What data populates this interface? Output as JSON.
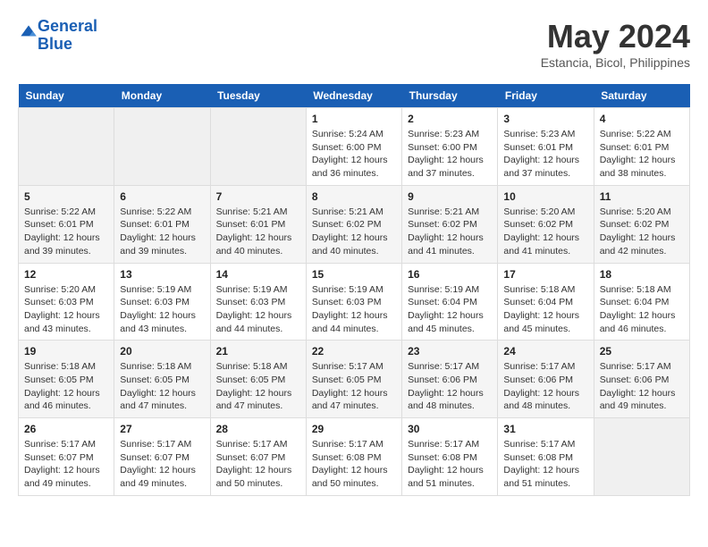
{
  "header": {
    "logo_line1": "General",
    "logo_line2": "Blue",
    "month_title": "May 2024",
    "location": "Estancia, Bicol, Philippines"
  },
  "weekdays": [
    "Sunday",
    "Monday",
    "Tuesday",
    "Wednesday",
    "Thursday",
    "Friday",
    "Saturday"
  ],
  "weeks": [
    [
      {
        "day": "",
        "empty": true
      },
      {
        "day": "",
        "empty": true
      },
      {
        "day": "",
        "empty": true
      },
      {
        "day": "1",
        "sunrise": "5:24 AM",
        "sunset": "6:00 PM",
        "daylight": "12 hours and 36 minutes."
      },
      {
        "day": "2",
        "sunrise": "5:23 AM",
        "sunset": "6:00 PM",
        "daylight": "12 hours and 37 minutes."
      },
      {
        "day": "3",
        "sunrise": "5:23 AM",
        "sunset": "6:01 PM",
        "daylight": "12 hours and 37 minutes."
      },
      {
        "day": "4",
        "sunrise": "5:22 AM",
        "sunset": "6:01 PM",
        "daylight": "12 hours and 38 minutes."
      }
    ],
    [
      {
        "day": "5",
        "sunrise": "5:22 AM",
        "sunset": "6:01 PM",
        "daylight": "12 hours and 39 minutes."
      },
      {
        "day": "6",
        "sunrise": "5:22 AM",
        "sunset": "6:01 PM",
        "daylight": "12 hours and 39 minutes."
      },
      {
        "day": "7",
        "sunrise": "5:21 AM",
        "sunset": "6:01 PM",
        "daylight": "12 hours and 40 minutes."
      },
      {
        "day": "8",
        "sunrise": "5:21 AM",
        "sunset": "6:02 PM",
        "daylight": "12 hours and 40 minutes."
      },
      {
        "day": "9",
        "sunrise": "5:21 AM",
        "sunset": "6:02 PM",
        "daylight": "12 hours and 41 minutes."
      },
      {
        "day": "10",
        "sunrise": "5:20 AM",
        "sunset": "6:02 PM",
        "daylight": "12 hours and 41 minutes."
      },
      {
        "day": "11",
        "sunrise": "5:20 AM",
        "sunset": "6:02 PM",
        "daylight": "12 hours and 42 minutes."
      }
    ],
    [
      {
        "day": "12",
        "sunrise": "5:20 AM",
        "sunset": "6:03 PM",
        "daylight": "12 hours and 43 minutes."
      },
      {
        "day": "13",
        "sunrise": "5:19 AM",
        "sunset": "6:03 PM",
        "daylight": "12 hours and 43 minutes."
      },
      {
        "day": "14",
        "sunrise": "5:19 AM",
        "sunset": "6:03 PM",
        "daylight": "12 hours and 44 minutes."
      },
      {
        "day": "15",
        "sunrise": "5:19 AM",
        "sunset": "6:03 PM",
        "daylight": "12 hours and 44 minutes."
      },
      {
        "day": "16",
        "sunrise": "5:19 AM",
        "sunset": "6:04 PM",
        "daylight": "12 hours and 45 minutes."
      },
      {
        "day": "17",
        "sunrise": "5:18 AM",
        "sunset": "6:04 PM",
        "daylight": "12 hours and 45 minutes."
      },
      {
        "day": "18",
        "sunrise": "5:18 AM",
        "sunset": "6:04 PM",
        "daylight": "12 hours and 46 minutes."
      }
    ],
    [
      {
        "day": "19",
        "sunrise": "5:18 AM",
        "sunset": "6:05 PM",
        "daylight": "12 hours and 46 minutes."
      },
      {
        "day": "20",
        "sunrise": "5:18 AM",
        "sunset": "6:05 PM",
        "daylight": "12 hours and 47 minutes."
      },
      {
        "day": "21",
        "sunrise": "5:18 AM",
        "sunset": "6:05 PM",
        "daylight": "12 hours and 47 minutes."
      },
      {
        "day": "22",
        "sunrise": "5:17 AM",
        "sunset": "6:05 PM",
        "daylight": "12 hours and 47 minutes."
      },
      {
        "day": "23",
        "sunrise": "5:17 AM",
        "sunset": "6:06 PM",
        "daylight": "12 hours and 48 minutes."
      },
      {
        "day": "24",
        "sunrise": "5:17 AM",
        "sunset": "6:06 PM",
        "daylight": "12 hours and 48 minutes."
      },
      {
        "day": "25",
        "sunrise": "5:17 AM",
        "sunset": "6:06 PM",
        "daylight": "12 hours and 49 minutes."
      }
    ],
    [
      {
        "day": "26",
        "sunrise": "5:17 AM",
        "sunset": "6:07 PM",
        "daylight": "12 hours and 49 minutes."
      },
      {
        "day": "27",
        "sunrise": "5:17 AM",
        "sunset": "6:07 PM",
        "daylight": "12 hours and 49 minutes."
      },
      {
        "day": "28",
        "sunrise": "5:17 AM",
        "sunset": "6:07 PM",
        "daylight": "12 hours and 50 minutes."
      },
      {
        "day": "29",
        "sunrise": "5:17 AM",
        "sunset": "6:08 PM",
        "daylight": "12 hours and 50 minutes."
      },
      {
        "day": "30",
        "sunrise": "5:17 AM",
        "sunset": "6:08 PM",
        "daylight": "12 hours and 51 minutes."
      },
      {
        "day": "31",
        "sunrise": "5:17 AM",
        "sunset": "6:08 PM",
        "daylight": "12 hours and 51 minutes."
      },
      {
        "day": "",
        "empty": true
      }
    ]
  ]
}
